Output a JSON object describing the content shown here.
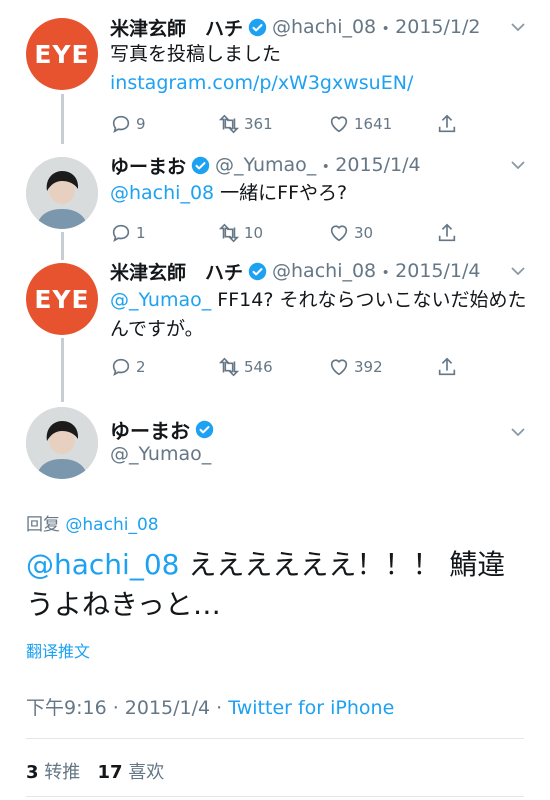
{
  "tweets": [
    {
      "name": "米津玄師　ハチ",
      "handle": "@hachi_08",
      "sep": "・",
      "date": "2015/1/2",
      "text": "写真を投稿しました ",
      "link": "instagram.com/p/xW3gxwsuEN/",
      "replies": "9",
      "retweets": "361",
      "likes": "1641",
      "avatar_text": "EYE"
    },
    {
      "name": "ゆーまお",
      "handle": "@_Yumao_",
      "sep": "・",
      "date": "2015/1/4",
      "mention": "@hachi_08",
      "text": " 一緒にFFやろ?",
      "replies": "1",
      "retweets": "10",
      "likes": "30"
    },
    {
      "name": "米津玄師　ハチ",
      "handle": "@hachi_08",
      "sep": "・",
      "date": "2015/1/4",
      "mention": "@_Yumao_",
      "text": " FF14? それならついこないだ始めたんですが。",
      "replies": "2",
      "retweets": "546",
      "likes": "392",
      "avatar_text": "EYE"
    }
  ],
  "focus": {
    "name": "ゆーまお",
    "handle": "@_Yumao_",
    "reply_label": "回复",
    "reply_to": "@hachi_08",
    "mention": "@hachi_08",
    "text": " ええええええ！！！ 鯖違うよねきっと…",
    "translate": "翻译推文",
    "time": "下午9:16",
    "sep1": " · ",
    "date": "2015/1/4",
    "sep2": " · ",
    "source": "Twitter for iPhone",
    "retweet_count": "3",
    "retweet_label": "转推",
    "like_count": "17",
    "like_label": "喜欢"
  },
  "colors": {
    "accent": "#1da1f2",
    "muted": "#657786",
    "eye_orange": "#e8532f"
  }
}
